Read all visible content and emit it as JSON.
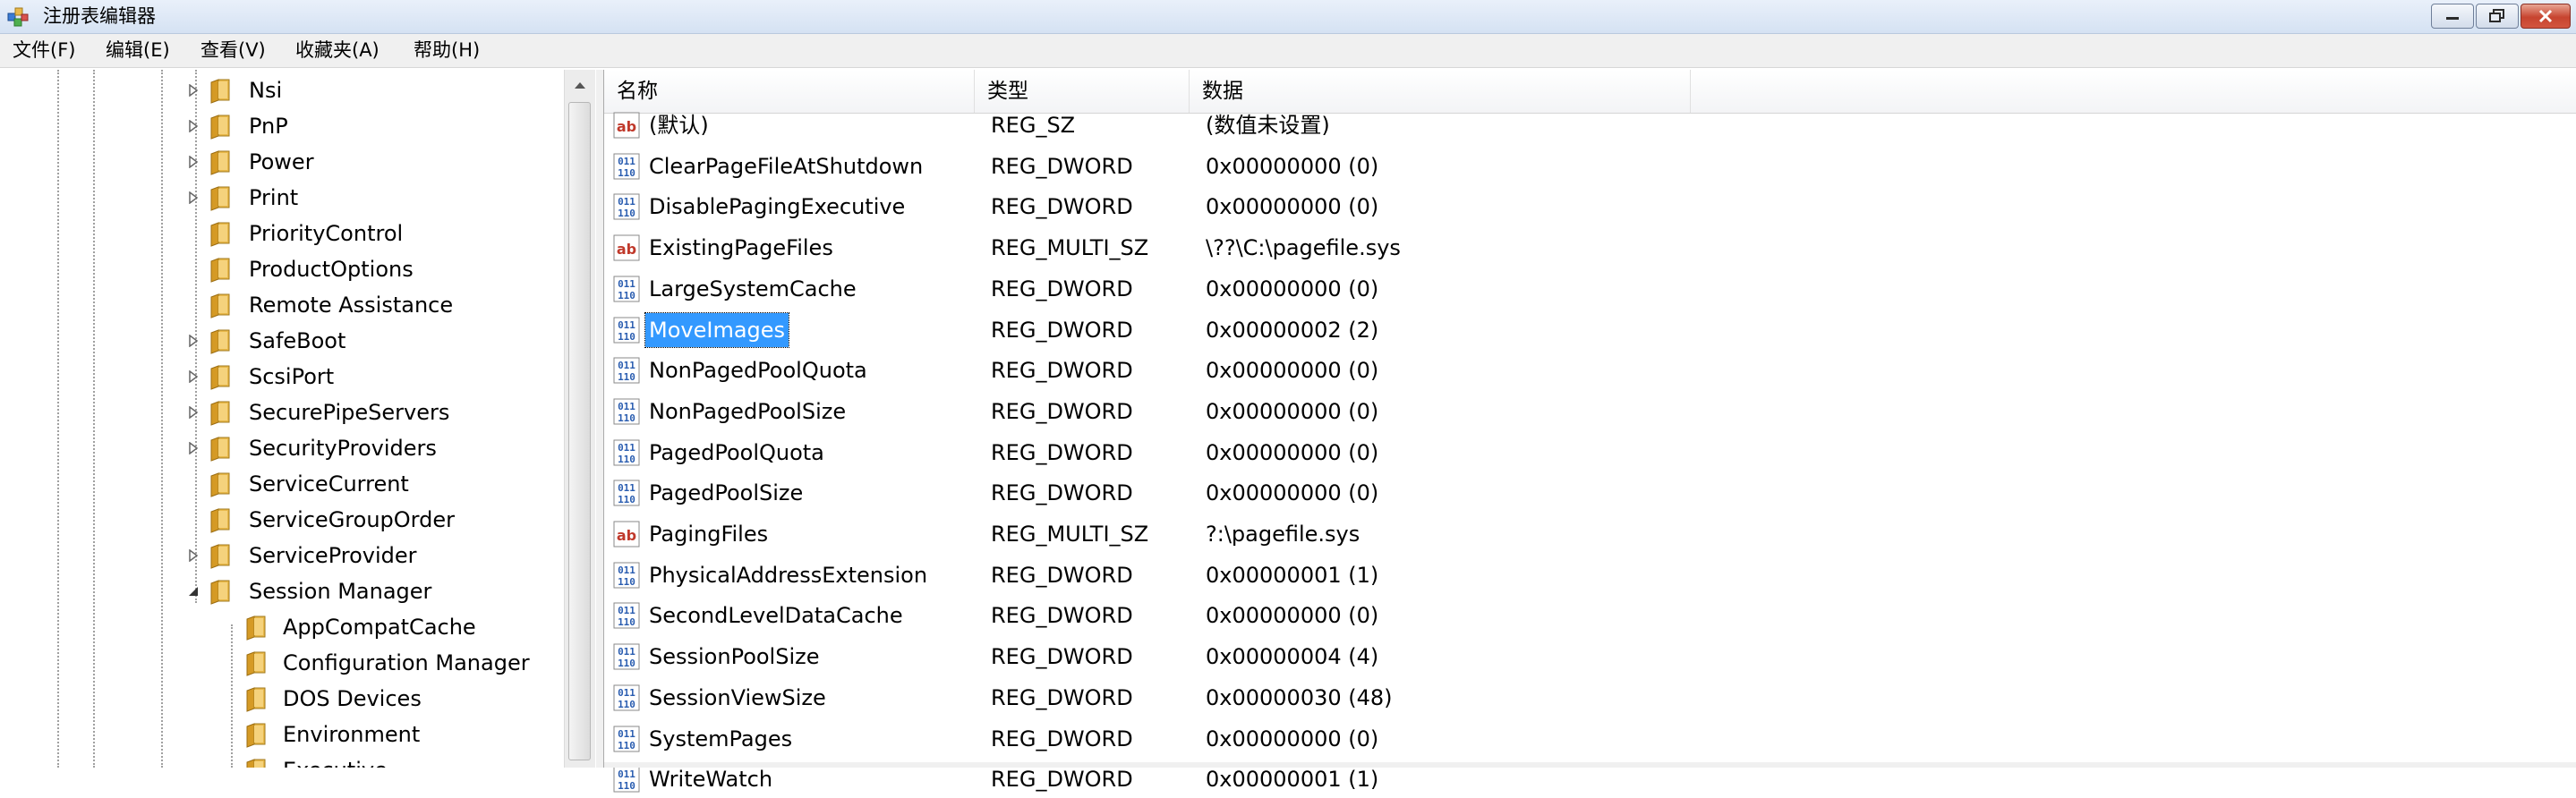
{
  "window": {
    "title": "注册表编辑器",
    "icon": "regedit-icon",
    "controls": [
      "minimize-icon",
      "maximize-icon",
      "close-icon"
    ]
  },
  "menu": {
    "items": [
      "文件(F)",
      "编辑(E)",
      "查看(V)",
      "收藏夹(A)",
      "帮助(H)"
    ]
  },
  "tree": {
    "items": [
      {
        "label": "Nsi",
        "expander": "collapsed",
        "level": 1
      },
      {
        "label": "PnP",
        "expander": "collapsed",
        "level": 1
      },
      {
        "label": "Power",
        "expander": "collapsed",
        "level": 1
      },
      {
        "label": "Print",
        "expander": "collapsed",
        "level": 1
      },
      {
        "label": "PriorityControl",
        "expander": "none",
        "level": 1
      },
      {
        "label": "ProductOptions",
        "expander": "none",
        "level": 1
      },
      {
        "label": "Remote Assistance",
        "expander": "none",
        "level": 1
      },
      {
        "label": "SafeBoot",
        "expander": "collapsed",
        "level": 1
      },
      {
        "label": "ScsiPort",
        "expander": "collapsed",
        "level": 1
      },
      {
        "label": "SecurePipeServers",
        "expander": "collapsed",
        "level": 1
      },
      {
        "label": "SecurityProviders",
        "expander": "collapsed",
        "level": 1
      },
      {
        "label": "ServiceCurrent",
        "expander": "none",
        "level": 1
      },
      {
        "label": "ServiceGroupOrder",
        "expander": "none",
        "level": 1
      },
      {
        "label": "ServiceProvider",
        "expander": "collapsed",
        "level": 1
      },
      {
        "label": "Session Manager",
        "expander": "expanded",
        "level": 1
      },
      {
        "label": "AppCompatCache",
        "expander": "none",
        "level": 2
      },
      {
        "label": "Configuration Manager",
        "expander": "none",
        "level": 2
      },
      {
        "label": "DOS Devices",
        "expander": "none",
        "level": 2
      },
      {
        "label": "Environment",
        "expander": "none",
        "level": 2
      },
      {
        "label": "Executive",
        "expander": "none",
        "level": 2
      }
    ]
  },
  "list": {
    "columns": [
      "名称",
      "类型",
      "数据"
    ],
    "rows": [
      {
        "name": "(默认)",
        "type": "REG_SZ",
        "data": "(数值未设置)",
        "icon": "string-value-icon",
        "selected": false
      },
      {
        "name": "ClearPageFileAtShutdown",
        "type": "REG_DWORD",
        "data": "0x00000000 (0)",
        "icon": "binary-value-icon",
        "selected": false
      },
      {
        "name": "DisablePagingExecutive",
        "type": "REG_DWORD",
        "data": "0x00000000 (0)",
        "icon": "binary-value-icon",
        "selected": false
      },
      {
        "name": "ExistingPageFiles",
        "type": "REG_MULTI_SZ",
        "data": "\\??\\C:\\pagefile.sys",
        "icon": "string-value-icon",
        "selected": false
      },
      {
        "name": "LargeSystemCache",
        "type": "REG_DWORD",
        "data": "0x00000000 (0)",
        "icon": "binary-value-icon",
        "selected": false
      },
      {
        "name": "MoveImages",
        "type": "REG_DWORD",
        "data": "0x00000002 (2)",
        "icon": "binary-value-icon",
        "selected": true
      },
      {
        "name": "NonPagedPoolQuota",
        "type": "REG_DWORD",
        "data": "0x00000000 (0)",
        "icon": "binary-value-icon",
        "selected": false
      },
      {
        "name": "NonPagedPoolSize",
        "type": "REG_DWORD",
        "data": "0x00000000 (0)",
        "icon": "binary-value-icon",
        "selected": false
      },
      {
        "name": "PagedPoolQuota",
        "type": "REG_DWORD",
        "data": "0x00000000 (0)",
        "icon": "binary-value-icon",
        "selected": false
      },
      {
        "name": "PagedPoolSize",
        "type": "REG_DWORD",
        "data": "0x00000000 (0)",
        "icon": "binary-value-icon",
        "selected": false
      },
      {
        "name": "PagingFiles",
        "type": "REG_MULTI_SZ",
        "data": "?:\\pagefile.sys",
        "icon": "string-value-icon",
        "selected": false
      },
      {
        "name": "PhysicalAddressExtension",
        "type": "REG_DWORD",
        "data": "0x00000001 (1)",
        "icon": "binary-value-icon",
        "selected": false
      },
      {
        "name": "SecondLevelDataCache",
        "type": "REG_DWORD",
        "data": "0x00000000 (0)",
        "icon": "binary-value-icon",
        "selected": false
      },
      {
        "name": "SessionPoolSize",
        "type": "REG_DWORD",
        "data": "0x00000004 (4)",
        "icon": "binary-value-icon",
        "selected": false
      },
      {
        "name": "SessionViewSize",
        "type": "REG_DWORD",
        "data": "0x00000030 (48)",
        "icon": "binary-value-icon",
        "selected": false
      },
      {
        "name": "SystemPages",
        "type": "REG_DWORD",
        "data": "0x00000000 (0)",
        "icon": "binary-value-icon",
        "selected": false
      },
      {
        "name": "WriteWatch",
        "type": "REG_DWORD",
        "data": "0x00000001 (1)",
        "icon": "binary-value-icon",
        "selected": false
      }
    ]
  },
  "colors": {
    "selection": "#3399ff",
    "folder": "#e8b84a",
    "string_icon": "#c0392b",
    "binary_icon": "#2a5db0"
  }
}
